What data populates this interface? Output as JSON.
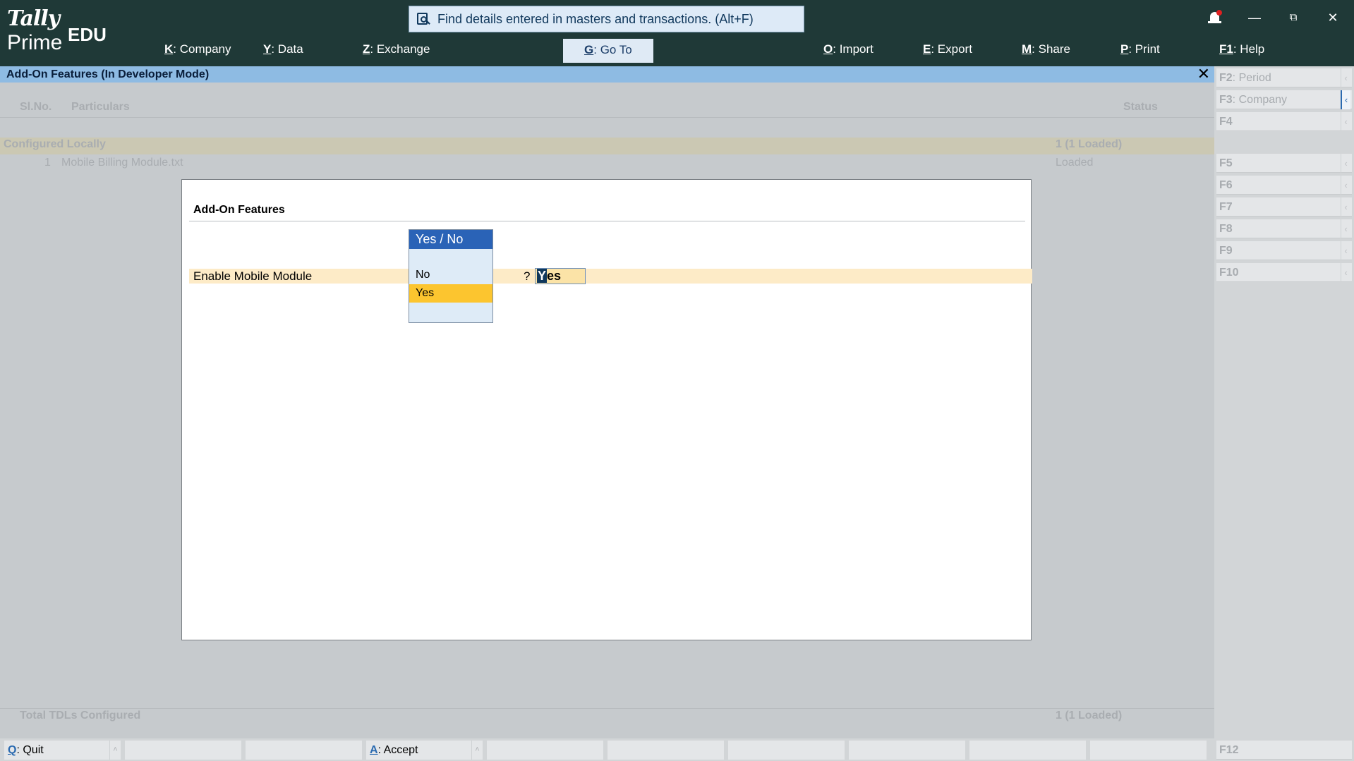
{
  "logo": {
    "tally": "Tally",
    "prime": "Prime",
    "edition": "EDU"
  },
  "search": {
    "text": "Find details entered in masters and transactions. (Alt+F)"
  },
  "menu": [
    {
      "key": "K",
      "label": "Company"
    },
    {
      "key": "Y",
      "label": "Data"
    },
    {
      "key": "Z",
      "label": "Exchange"
    },
    {
      "key": "G",
      "label": "Go To"
    },
    {
      "key": "O",
      "label": "Import"
    },
    {
      "key": "E",
      "label": "Export"
    },
    {
      "key": "M",
      "label": "Share"
    },
    {
      "key": "P",
      "label": "Print"
    },
    {
      "key": "F1",
      "label": "Help"
    }
  ],
  "title_bar": {
    "title": "Add-On Features (In Developer Mode)"
  },
  "table": {
    "col_slno": "Sl.No.",
    "col_particulars": "Particulars",
    "col_status": "Status",
    "group_label": "Configured Locally",
    "group_status": "1 (1 Loaded)",
    "row_no": "1",
    "row_name": "Mobile Billing Module.txt",
    "row_status": "Loaded",
    "total_label": "Total TDLs Configured",
    "total_status": "1 (1 Loaded)"
  },
  "modal": {
    "title": "Add-On Features",
    "field_label": "Enable Mobile Module",
    "field_q": "?",
    "field_value_first": "Y",
    "field_value_rest": "es"
  },
  "dropdown": {
    "header": "Yes / No",
    "options": [
      "No",
      "Yes"
    ],
    "selected": "Yes"
  },
  "function_keys": [
    {
      "key": "F2",
      "label": "Period"
    },
    {
      "key": "F3",
      "label": "Company"
    },
    {
      "key": "F4",
      "label": ""
    },
    {
      "key": "F5",
      "label": ""
    },
    {
      "key": "F6",
      "label": ""
    },
    {
      "key": "F7",
      "label": ""
    },
    {
      "key": "F8",
      "label": ""
    },
    {
      "key": "F9",
      "label": ""
    },
    {
      "key": "F10",
      "label": ""
    },
    {
      "key": "F12",
      "label": ""
    }
  ],
  "bottom_buttons": [
    {
      "key": "Q",
      "label": "Quit"
    },
    {
      "key": "A",
      "label": "Accept"
    }
  ],
  "colors": {
    "topbar": "#1f3937",
    "titlebar": "#8ebbe3",
    "highlight_row": "#fdebc7",
    "dropdown_header": "#2a63b7",
    "dropdown_selected": "#fcc52f"
  }
}
